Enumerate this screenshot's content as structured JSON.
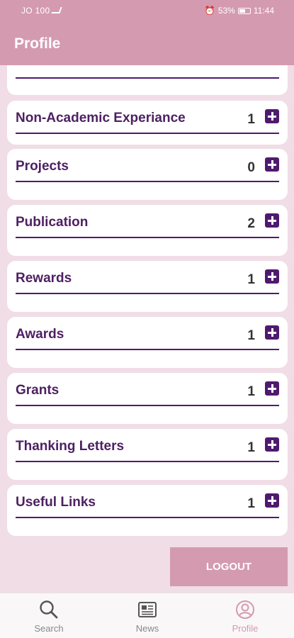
{
  "status_bar": {
    "carrier": "JO 100",
    "battery": "53%",
    "time": "11:44"
  },
  "app_bar": {
    "title": "Profile"
  },
  "sections": [
    {
      "label": "",
      "count": ""
    },
    {
      "label": "Non-Academic Experiance",
      "count": "1"
    },
    {
      "label": "Projects",
      "count": "0"
    },
    {
      "label": "Publication",
      "count": "2"
    },
    {
      "label": "Rewards",
      "count": "1"
    },
    {
      "label": "Awards",
      "count": "1"
    },
    {
      "label": "Grants",
      "count": "1"
    },
    {
      "label": "Thanking Letters",
      "count": "1"
    },
    {
      "label": "Useful Links",
      "count": "1"
    }
  ],
  "logout_label": "LOGOUT",
  "nav": [
    {
      "label": "Search",
      "icon": "search-icon",
      "active": false
    },
    {
      "label": "News",
      "icon": "news-icon",
      "active": false
    },
    {
      "label": "Profile",
      "icon": "profile-icon",
      "active": true
    }
  ],
  "colors": {
    "accent": "#d49ab0",
    "primary": "#4e1a6e",
    "background": "#f0dde5"
  }
}
